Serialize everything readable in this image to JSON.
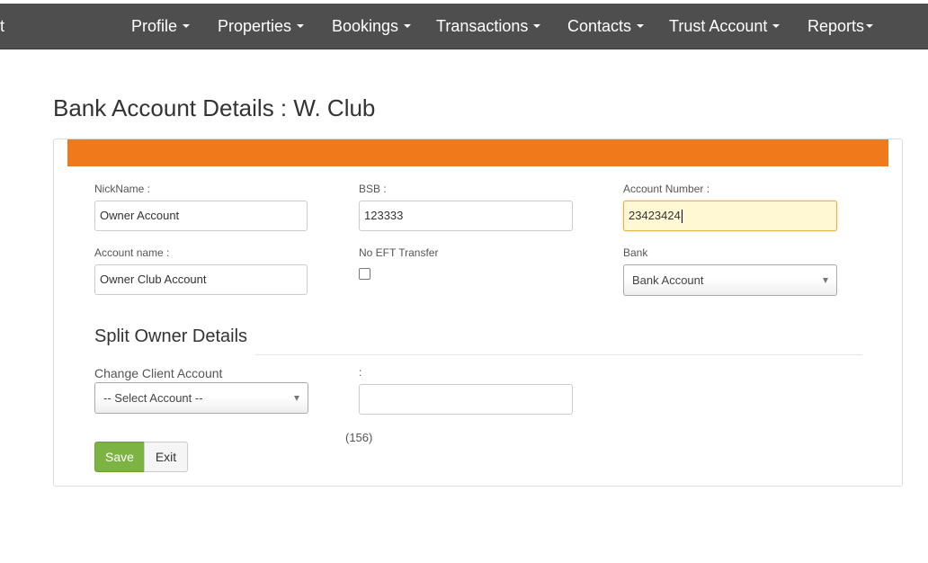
{
  "nav": {
    "brand_fragment": "t",
    "items": [
      {
        "label": "Profile"
      },
      {
        "label": "Properties"
      },
      {
        "label": "Bookings"
      },
      {
        "label": "Transactions"
      },
      {
        "label": "Contacts"
      },
      {
        "label": "Trust Account"
      },
      {
        "label": "Reports"
      }
    ]
  },
  "page": {
    "title": "Bank Account Details : W. Club"
  },
  "form": {
    "nickname": {
      "label": "NickName :",
      "value": "Owner  Account"
    },
    "bsb": {
      "label": "BSB :",
      "value": "123333"
    },
    "account_number": {
      "label": "Account Number :",
      "value": "23423424"
    },
    "account_name": {
      "label": "Account name :",
      "value": "Owner  Club Account"
    },
    "no_eft": {
      "label": "No EFT Transfer",
      "checked": false
    },
    "bank": {
      "label": "Bank",
      "selected": "Bank Account"
    }
  },
  "split": {
    "title": "Split Owner Details",
    "change_client_label": "Change Client Account",
    "select_placeholder": "-- Select Account --",
    "second_label": ":",
    "second_value": "",
    "count_text": "(156)"
  },
  "actions": {
    "save_label": "Save",
    "exit_label": "Exit"
  },
  "colors": {
    "navbar": "#4e4e4e",
    "panel_header": "#f07a1b",
    "save_button": "#7cb342",
    "focused_field": "#fff8d2"
  }
}
